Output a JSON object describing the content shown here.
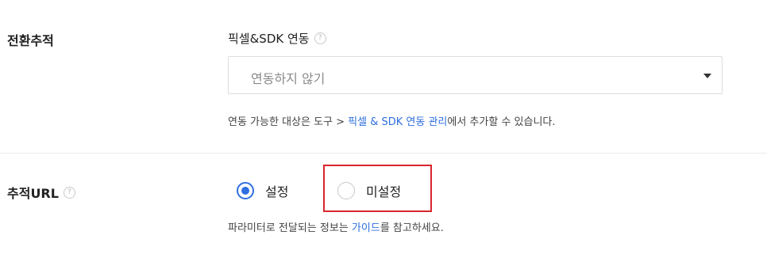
{
  "conversion": {
    "section_label": "전환추적",
    "field_label": "픽셀&SDK 연동",
    "help_icon": "question-circle-icon",
    "select": {
      "value": "연동하지 않기",
      "caret_icon": "triangle-down-icon"
    },
    "helper": {
      "prefix": "연동 가능한 대상은 도구 > ",
      "link": "픽셀 & SDK 연동 관리",
      "suffix": "에서 추가할 수 있습니다."
    }
  },
  "tracking_url": {
    "section_label": "추적URL",
    "help_icon": "question-circle-icon",
    "options": [
      {
        "label": "설정",
        "checked": true
      },
      {
        "label": "미설정",
        "checked": false
      }
    ],
    "helper": {
      "prefix": "파라미터로 전달되는 정보는 ",
      "link": "가이드",
      "suffix": "를 참고하세요."
    }
  },
  "colors": {
    "accent": "#2f6fe0",
    "highlight": "#d9262c",
    "divider": "#ececec"
  }
}
